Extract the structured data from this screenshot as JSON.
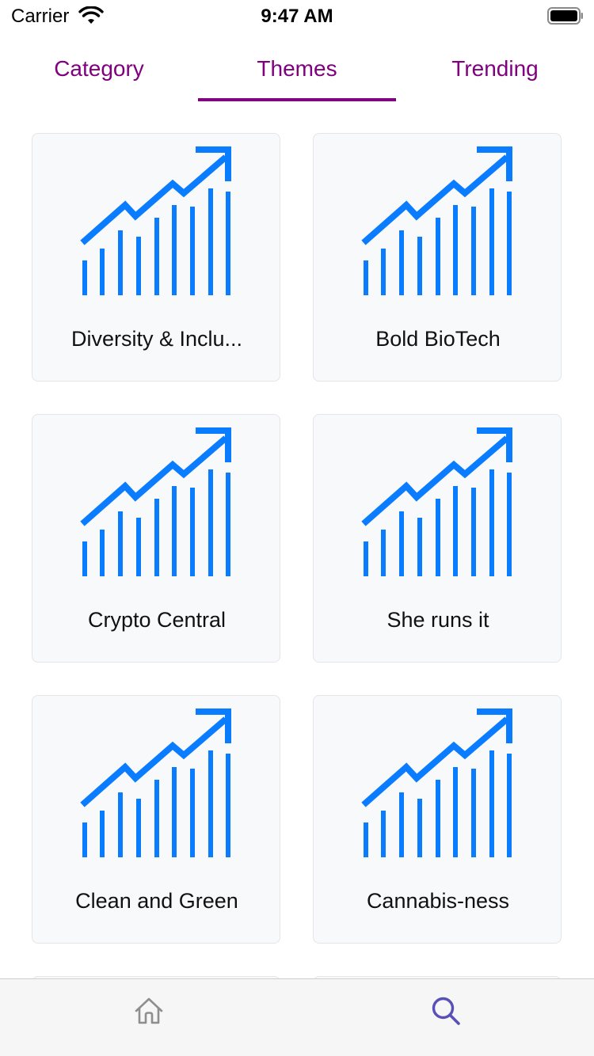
{
  "status_bar": {
    "carrier": "Carrier",
    "time": "9:47 AM",
    "wifi_icon": "wifi-icon",
    "battery_icon": "battery-icon"
  },
  "tabs": [
    {
      "label": "Category",
      "selected": false
    },
    {
      "label": "Themes",
      "selected": true
    },
    {
      "label": "Trending",
      "selected": false
    }
  ],
  "themes": [
    {
      "label": "Diversity & Inclu...",
      "icon": "growth-chart-icon"
    },
    {
      "label": "Bold BioTech",
      "icon": "growth-chart-icon"
    },
    {
      "label": "Crypto Central",
      "icon": "growth-chart-icon"
    },
    {
      "label": "She runs it",
      "icon": "growth-chart-icon"
    },
    {
      "label": "Clean and Green",
      "icon": "growth-chart-icon"
    },
    {
      "label": "Cannabis-ness",
      "icon": "growth-chart-icon"
    }
  ],
  "bottom_nav": [
    {
      "icon": "home-icon",
      "active": false
    },
    {
      "icon": "search-icon",
      "active": true
    }
  ],
  "colors": {
    "accent": "#800080",
    "icon_blue": "#0a7cff",
    "active_nav": "#5850b8",
    "inactive_nav": "#8e8e8e"
  }
}
